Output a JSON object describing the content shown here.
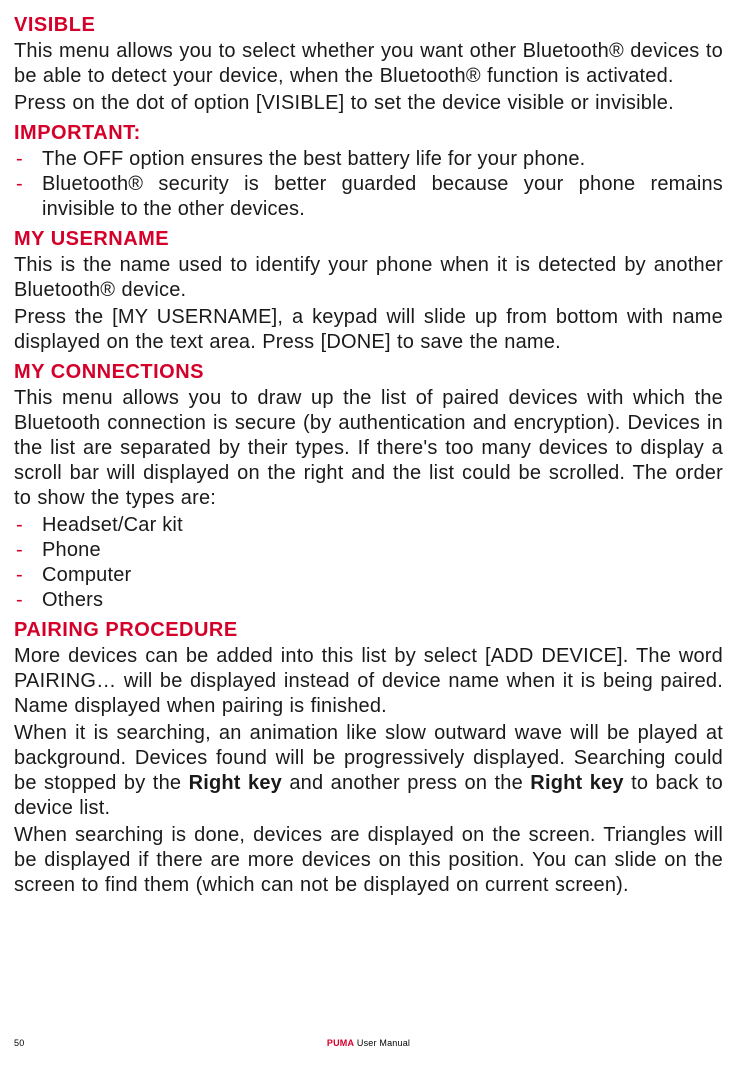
{
  "sections": {
    "visible": {
      "heading": "VISIBLE",
      "p1": "This menu allows you to select whether you want other Bluetooth® devices to be able to detect your device, when the Bluetooth® function is activated.",
      "p2": "Press on the dot of option [VISIBLE] to set the device visible or invisible."
    },
    "important": {
      "heading": "IMPORTANT:",
      "items": [
        "The OFF option ensures the best battery life for your phone.",
        "Bluetooth® security is better guarded because your phone remains invisible to the other devices."
      ]
    },
    "myusername": {
      "heading": "MY USERNAME",
      "p1": "This is the name used to identify your phone when it is detected by another Bluetooth® device.",
      "p2": "Press the [MY USERNAME], a keypad will slide up from bottom with name displayed on the text area. Press [DONE] to save the name."
    },
    "myconnections": {
      "heading": "MY CONNECTIONS",
      "p1": "This menu allows you to draw up the list of paired devices with which the Bluetooth connection is secure (by authentication and encryption). Devices in the list are separated by their types. If there's too many devices to display a scroll bar will displayed on the right and the list could be scrolled. The order to show the types are:",
      "items": [
        "Headset/Car kit",
        "Phone",
        "Computer",
        "Others"
      ]
    },
    "pairing": {
      "heading": "PAIRING PROCEDURE",
      "p1": "More devices can be added into this list by select [ADD DEVICE]. The word PAIRING… will be displayed instead of device name when it is being paired. Name displayed when pairing is finished.",
      "p2_a": "When it is searching, an animation like slow outward wave will be played at background. Devices found will be progressively displayed. Searching could be stopped by the ",
      "p2_b": "Right key",
      "p2_c": " and another press on the ",
      "p2_d": "Right key",
      "p2_e": " to back to device list.",
      "p3": "When searching is done, devices are displayed on the screen. Triangles will be displayed if there are more devices on this position. You can slide on the screen to find them (which can not be displayed on current screen)."
    }
  },
  "footer": {
    "page": "50",
    "brand": "PUMA",
    "manual": " User Manual"
  }
}
